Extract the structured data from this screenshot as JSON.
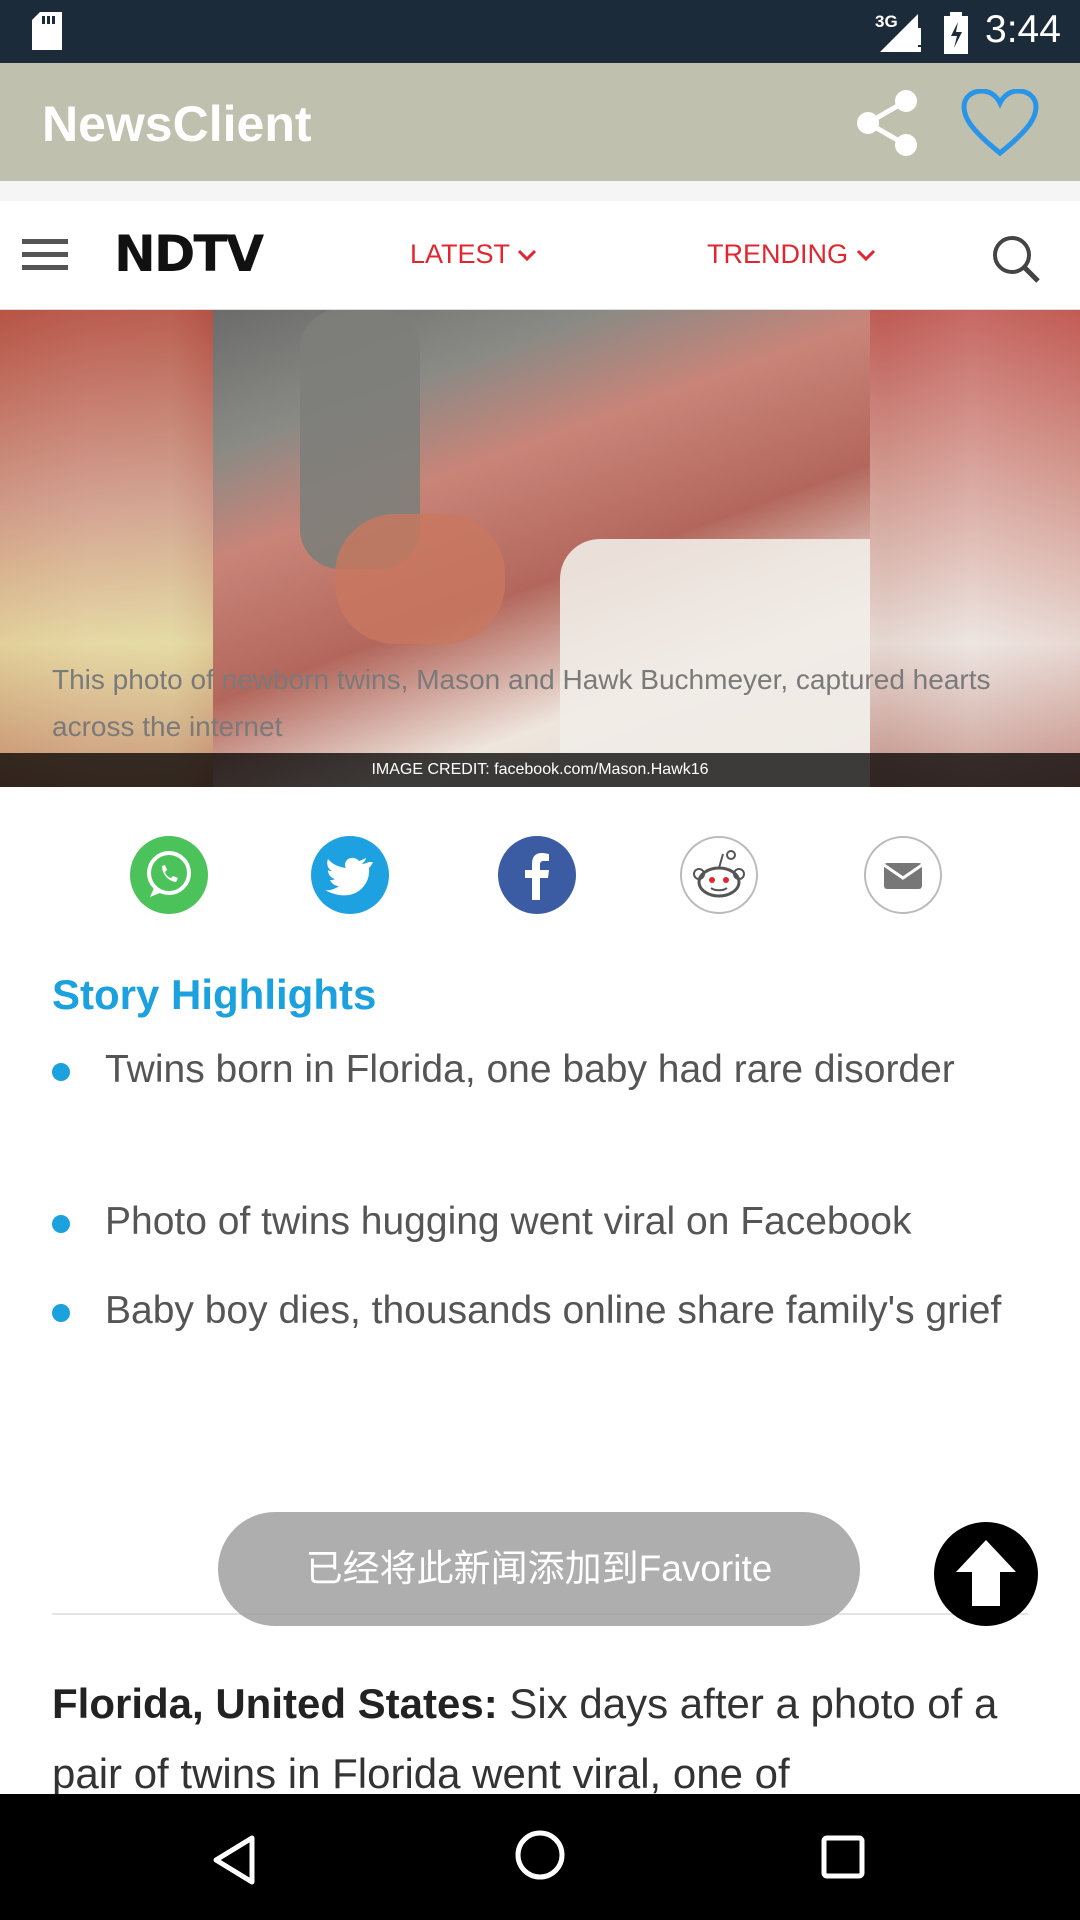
{
  "status_bar": {
    "time": "3:44",
    "network": "3G",
    "icons": [
      "sd-card-icon",
      "signal-icon",
      "battery-icon"
    ]
  },
  "app_bar": {
    "title": "NewsClient",
    "icons": [
      "share-icon",
      "heart-icon"
    ],
    "accent": "#2a95e8",
    "background": "#bfc0ad"
  },
  "site_nav": {
    "logo": "NDTV",
    "latest_label": "LATEST",
    "trending_label": "TRENDING",
    "accent": "#e2262f"
  },
  "photo": {
    "credit": "IMAGE CREDIT: facebook.com/Mason.Hawk16"
  },
  "caption": "This photo of newborn twins, Mason and Hawk Buchmeyer, captured hearts across the internet",
  "share_buttons": [
    {
      "name": "whatsapp",
      "icon": "whatsapp-icon",
      "color": "#4cc25a"
    },
    {
      "name": "twitter",
      "icon": "twitter-icon",
      "color": "#1da1e0"
    },
    {
      "name": "facebook",
      "icon": "facebook-icon",
      "color": "#3b5ba3"
    },
    {
      "name": "reddit",
      "icon": "reddit-icon",
      "color": "#ffffff"
    },
    {
      "name": "email",
      "icon": "email-icon",
      "color": "#ffffff"
    }
  ],
  "highlights": {
    "title": "Story Highlights",
    "items": [
      "Twins born in Florida, one baby had rare disorder",
      "Photo of twins hugging went viral on Facebook",
      "Baby boy dies, thousands online share family's grief"
    ],
    "accent": "#1ba1de"
  },
  "article": {
    "dateline": "Florida, United States:",
    "text": " Six days after a photo of a pair of twins in Florida went viral, one of"
  },
  "toast": "已经将此新闻添加到Favorite",
  "fab_icon": "arrow-up-icon",
  "nav_bar": {
    "icons": [
      "back-icon",
      "home-icon",
      "recent-apps-icon"
    ]
  }
}
